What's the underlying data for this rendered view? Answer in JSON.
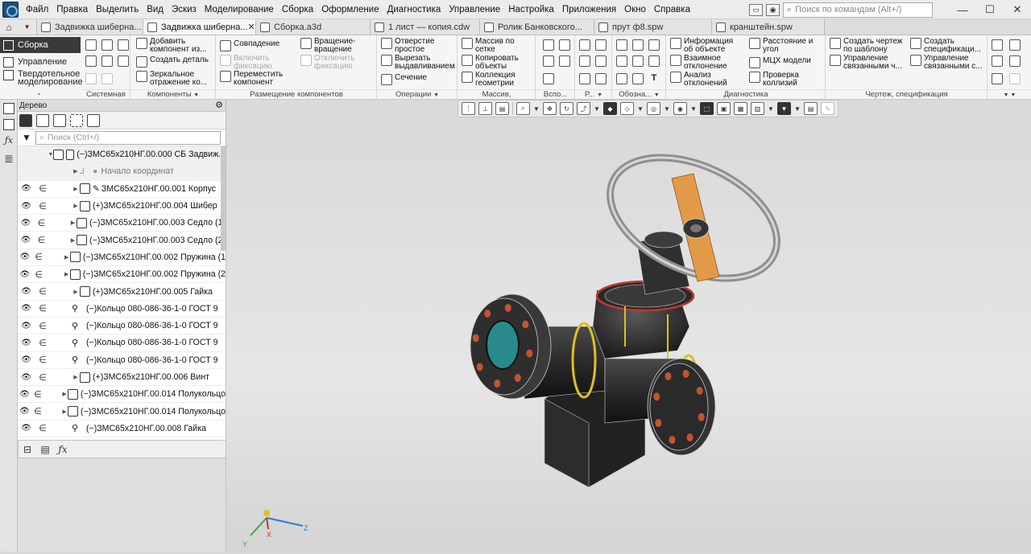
{
  "menu": [
    "Файл",
    "Правка",
    "Выделить",
    "Вид",
    "Эскиз",
    "Моделирование",
    "Сборка",
    "Оформление",
    "Диагностика",
    "Управление",
    "Настройка",
    "Приложения",
    "Окно",
    "Справка"
  ],
  "command_search": {
    "placeholder": "Поиск по командам (Alt+/)"
  },
  "window_controls": {
    "min": "—",
    "max": "☐",
    "close": "✕"
  },
  "tabs": [
    {
      "label": "Задвижка шиберна...",
      "active": false
    },
    {
      "label": "Задвижка шиберна...",
      "active": true,
      "close": "✕"
    },
    {
      "label": "Сборка.a3d",
      "active": false
    },
    {
      "label": "1 лист — копия.cdw",
      "active": false
    },
    {
      "label": "Ролик Банковского...",
      "active": false
    },
    {
      "label": "прут ф8.spw",
      "active": false
    },
    {
      "label": "кранштейн.spw",
      "active": false
    }
  ],
  "modes": {
    "assembly": "Сборка",
    "management": "Управление",
    "solid1": "Твердотельное",
    "solid2": "моделирование"
  },
  "ribbon": {
    "groups": {
      "system": "Системная",
      "components": "Компоненты",
      "placement": "Размещение компонентов",
      "operations": "Операции",
      "array": "Массив, копирование",
      "aux": "Вспо...",
      "r": "Р...",
      "designations": "Обозна...",
      "diagnostics": "Диагностика",
      "drawing": "Чертеж, спецификация"
    },
    "buttons": {
      "add_component": "Добавить\nкомпонент из...",
      "create_part": "Создать деталь",
      "mirror": "Зеркальное\nотражение ко...",
      "coincide": "Совпадение",
      "rotate": "Вращение-\nвращение",
      "fix_on": "Включить\nфиксацию",
      "fix_off": "Отключить\nфиксацию",
      "move": "Переместить\nкомпонент",
      "hole": "Отверстие\nпростое",
      "cut": "Вырезать\nвыдавливанием",
      "section": "Сечение",
      "grid_array": "Массив по\nсетке",
      "copy_obj": "Копировать\nобъекты",
      "geo_collection": "Коллекция\nгеометрии",
      "obj_info": "Информация\nоб объекте",
      "mutual_dev": "Взаимное\nотклонение",
      "dev_analysis": "Анализ\nотклонений",
      "distance": "Расстояние и\nугол",
      "mcc": "МЦХ модели",
      "collision": "Проверка\nколлизий",
      "create_drawing": "Создать чертеж\nпо шаблону",
      "manage_linked1": "Управление\nсвязанными ч...",
      "create_spec": "Создать\nспецификаци...",
      "manage_linked2": "Управление\nсвязанными с..."
    }
  },
  "tree": {
    "title": "Дерево",
    "search_placeholder": "Поиск (Ctrl+/)",
    "root": "(−)ЗМС65х210НГ.00.000 СБ Задвиж...",
    "origin": "Начало координат",
    "rows": [
      {
        "text": "ЗМС65х210НГ.00.001 Корпус",
        "prefix": "📌"
      },
      {
        "text": "(+)ЗМС65х210НГ.00.004 Шибер",
        "prefix": ""
      },
      {
        "text": "(−)ЗМС65х210НГ.00.003 Седло (1)",
        "prefix": ""
      },
      {
        "text": "(−)ЗМС65х210НГ.00.003 Седло (2)",
        "prefix": ""
      },
      {
        "text": "(−)ЗМС65х210НГ.00.002 Пружина (1",
        "prefix": ""
      },
      {
        "text": "(−)ЗМС65х210НГ.00.002 Пружина (2",
        "prefix": ""
      },
      {
        "text": "(+)ЗМС65х210НГ.00.005 Гайка",
        "prefix": ""
      },
      {
        "text": "(−)Кольцо 080-086-36-1-0 ГОСТ 9",
        "prefix": "ring"
      },
      {
        "text": "(−)Кольцо 080-086-36-1-0 ГОСТ 9",
        "prefix": "ring"
      },
      {
        "text": "(−)Кольцо 080-086-36-1-0 ГОСТ 9",
        "prefix": "ring"
      },
      {
        "text": "(−)Кольцо 080-086-36-1-0 ГОСТ 9",
        "prefix": "ring"
      },
      {
        "text": "(+)ЗМС65х210НГ.00.006 Винт",
        "prefix": ""
      },
      {
        "text": "(−)ЗМС65х210НГ.00.014 Полукольцо",
        "prefix": ""
      },
      {
        "text": "(−)ЗМС65х210НГ.00.014 Полукольцо",
        "prefix": ""
      },
      {
        "text": "(−)ЗМС65х210НГ.00.008 Гайка",
        "prefix": "ring"
      }
    ]
  },
  "axes": {
    "x": "X",
    "y": "Y",
    "z": "Z"
  },
  "colors": {
    "body": "#2b2b2b",
    "flange_holes": "#c0552e",
    "seal": "#e0c020",
    "handle_bar": "#e39a48",
    "wheel": "#a8a8a8",
    "bore": "#2a8a8c"
  }
}
